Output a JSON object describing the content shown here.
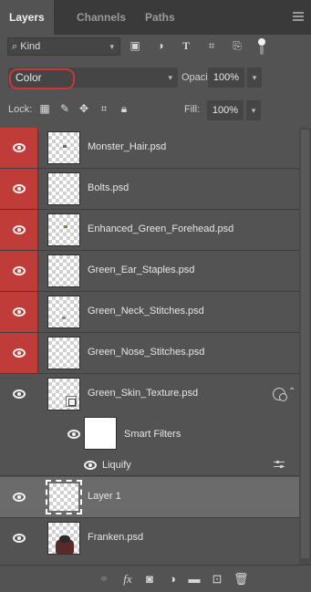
{
  "tabs": [
    {
      "label": "Layers",
      "active": true
    },
    {
      "label": "Channels",
      "active": false
    },
    {
      "label": "Paths",
      "active": false
    }
  ],
  "filter": {
    "kind_label": "Kind",
    "kind_icon": "search-icon",
    "icons": [
      "pixel-layer-filter-icon",
      "adjustment-filter-icon",
      "type-filter-icon",
      "shape-filter-icon",
      "smart-object-filter-icon"
    ],
    "filter_toggle": "on"
  },
  "blend": {
    "mode": "Color",
    "opacity_label": "Opacity:",
    "opacity_value": "100%"
  },
  "lock": {
    "label": "Lock:",
    "fill_label": "Fill:",
    "fill_value": "100%",
    "icons": [
      "lock-transparent-pixels-icon",
      "lock-image-pixels-icon",
      "lock-position-icon",
      "lock-artboard-icon",
      "lock-all-icon"
    ]
  },
  "layers": [
    {
      "name": "Monster_Hair.psd",
      "visible": true,
      "color": "red"
    },
    {
      "name": "Bolts.psd",
      "visible": true,
      "color": "red"
    },
    {
      "name": "Enhanced_Green_Forehead.psd",
      "visible": true,
      "color": "red"
    },
    {
      "name": "Green_Ear_Staples.psd",
      "visible": true,
      "color": "red"
    },
    {
      "name": "Green_Neck_Stitches.psd",
      "visible": true,
      "color": "red"
    },
    {
      "name": "Green_Nose_Stitches.psd",
      "visible": true,
      "color": "red"
    },
    {
      "name": "Green_Skin_Texture.psd",
      "visible": true,
      "color": "none",
      "smart_object": true,
      "has_filters": true
    }
  ],
  "smart_filters": {
    "label": "Smart Filters",
    "filters": [
      {
        "name": "Liquify"
      }
    ]
  },
  "layer1": {
    "name": "Layer 1",
    "selected": true
  },
  "layer_last": {
    "name": "Franken.psd"
  },
  "bottom_icons": [
    "link-layers-icon",
    "fx-icon",
    "add-mask-icon",
    "adjustment-layer-icon",
    "group-folder-icon",
    "new-layer-icon",
    "trash-icon"
  ],
  "colors": {
    "label_red": "#c03c38",
    "highlight_ring": "#d2323a",
    "panel_bg": "#535353",
    "tab_bar_bg": "#3a3a3a",
    "selected_row": "#6b6b6b"
  }
}
